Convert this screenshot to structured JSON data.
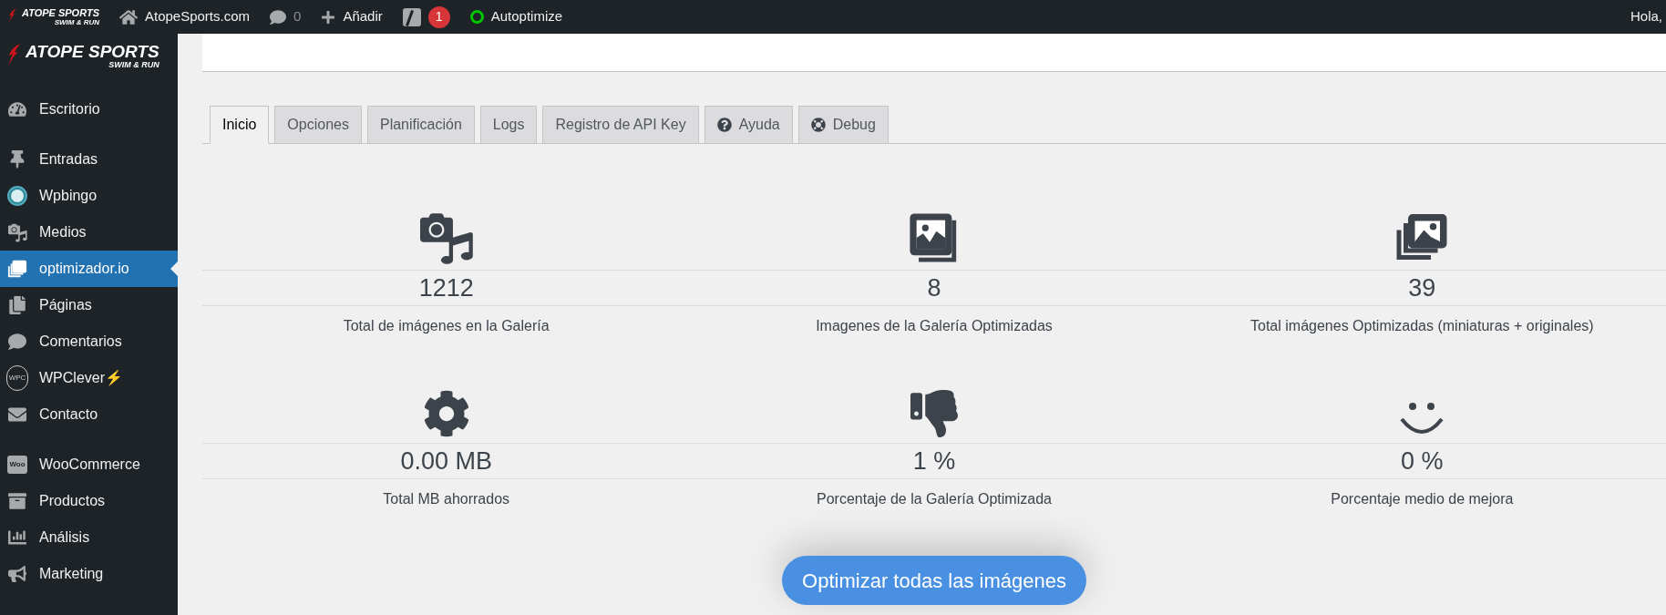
{
  "top_bar": {
    "logo": {
      "title": "ATOPE SPORTS",
      "subtitle": "SWIM & RUN"
    },
    "items": [
      {
        "kind": "home",
        "label": "AtopeSports.com"
      },
      {
        "kind": "comments",
        "label": "0"
      },
      {
        "kind": "add",
        "label": "Añadir"
      },
      {
        "kind": "yoast",
        "badge": "1"
      },
      {
        "kind": "status",
        "label": "Autoptimize",
        "color": "#00c800"
      }
    ],
    "greeting": "Hola,"
  },
  "sidebar": {
    "logo": {
      "title": "ATOPE SPORTS",
      "subtitle": "SWIM & RUN"
    },
    "groups": [
      [
        {
          "kind": "dashboard",
          "label": "Escritorio",
          "selected": false
        }
      ],
      [
        {
          "kind": "pin",
          "label": "Entradas",
          "selected": false
        },
        {
          "kind": "bingo",
          "label": "Wpbingo",
          "selected": false
        },
        {
          "kind": "media",
          "label": "Medios",
          "selected": false
        },
        {
          "kind": "images",
          "label": "optimizador.io",
          "selected": true
        },
        {
          "kind": "pages",
          "label": "Páginas",
          "selected": false
        },
        {
          "kind": "comments",
          "label": "Comentarios",
          "selected": false
        },
        {
          "kind": "bulb",
          "label": "WPClever⚡",
          "icon_text": "WPC",
          "selected": false
        },
        {
          "kind": "mail",
          "label": "Contacto",
          "selected": false
        }
      ],
      [
        {
          "kind": "woo",
          "label": "WooCommerce",
          "icon_text": "Woo",
          "selected": false
        },
        {
          "kind": "archive",
          "label": "Productos",
          "selected": false
        },
        {
          "kind": "chart",
          "label": "Análisis",
          "selected": false
        },
        {
          "kind": "megaphone",
          "label": "Marketing",
          "selected": false
        }
      ]
    ]
  },
  "tabs": [
    {
      "kind": "plain",
      "label": "Inicio",
      "selected": true
    },
    {
      "kind": "plain",
      "label": "Opciones",
      "selected": false
    },
    {
      "kind": "plain",
      "label": "Planificación",
      "selected": false
    },
    {
      "kind": "plain",
      "label": "Logs",
      "selected": false
    },
    {
      "kind": "plain",
      "label": "Registro de API Key",
      "selected": false
    },
    {
      "kind": "help",
      "label": "Ayuda",
      "selected": false
    },
    {
      "kind": "debug",
      "label": "Debug",
      "selected": false
    }
  ],
  "stats": [
    {
      "kind": "media",
      "value": "1212",
      "label": "Total de imágenes en la Galería"
    },
    {
      "kind": "gallery",
      "value": "8",
      "label": "Imagenes de la Galería Optimizadas"
    },
    {
      "kind": "images",
      "value": "39",
      "label": "Total imágenes Optimizadas (miniaturas + originales)"
    },
    {
      "kind": "gear",
      "value": "0.00 MB",
      "label": "Total MB ahorrados"
    },
    {
      "kind": "thumbs_down",
      "value": "1 %",
      "label": "Porcentaje de la Galería Optimizada"
    },
    {
      "kind": "smile",
      "value": "0 %",
      "label": "Porcentaje medio de mejora"
    }
  ],
  "optimize_button": "Optimizar todas las imágenes"
}
